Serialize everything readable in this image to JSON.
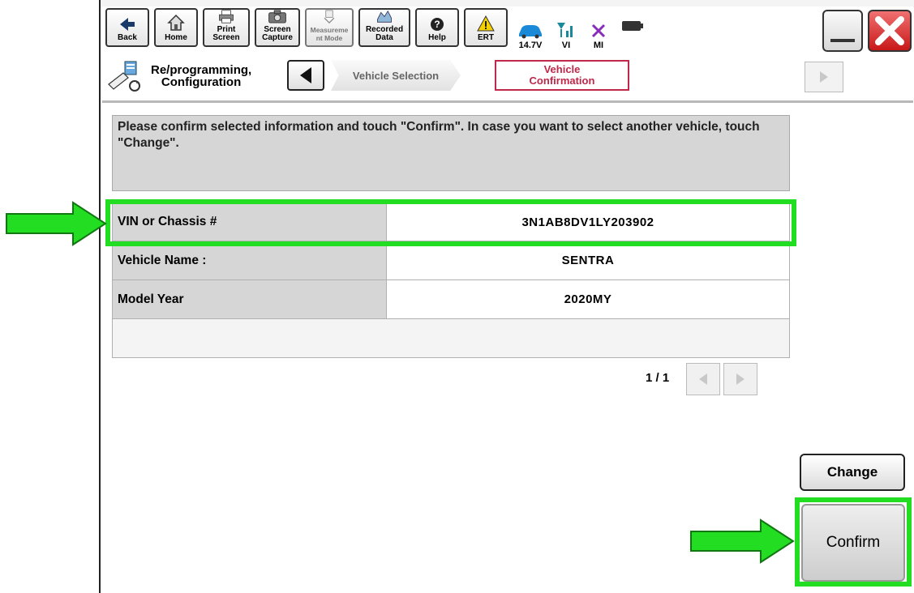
{
  "toolbar": {
    "buttons": [
      {
        "label": "Back"
      },
      {
        "label": "Home"
      },
      {
        "label": "Print Screen"
      },
      {
        "label": "Screen\nCapture"
      },
      {
        "label": "Measureme\nnt Mode"
      },
      {
        "label": "Recorded\nData"
      },
      {
        "label": "Help"
      },
      {
        "label": "ERT"
      }
    ],
    "status": {
      "voltage": "14.7V",
      "vi": "VI",
      "mi": "MI"
    }
  },
  "breadcrumb": {
    "home_label": "Re/programming,\nConfiguration",
    "step1": "Vehicle Selection",
    "step2": "Vehicle\nConfirmation"
  },
  "main": {
    "message": "Please confirm selected information and touch \"Confirm\". In case you want to select another vehicle, touch \"Change\".",
    "rows": [
      {
        "label": "VIN or Chassis #",
        "value": "3N1AB8DV1LY203902"
      },
      {
        "label": "Vehicle Name :",
        "value": "SENTRA"
      },
      {
        "label": "Model Year",
        "value": "2020MY"
      }
    ],
    "page": "1 / 1"
  },
  "actions": {
    "change": "Change",
    "confirm": "Confirm"
  },
  "colors": {
    "highlight": "#22dd22",
    "active_tab": "#c0284a",
    "close": "#d42020"
  }
}
